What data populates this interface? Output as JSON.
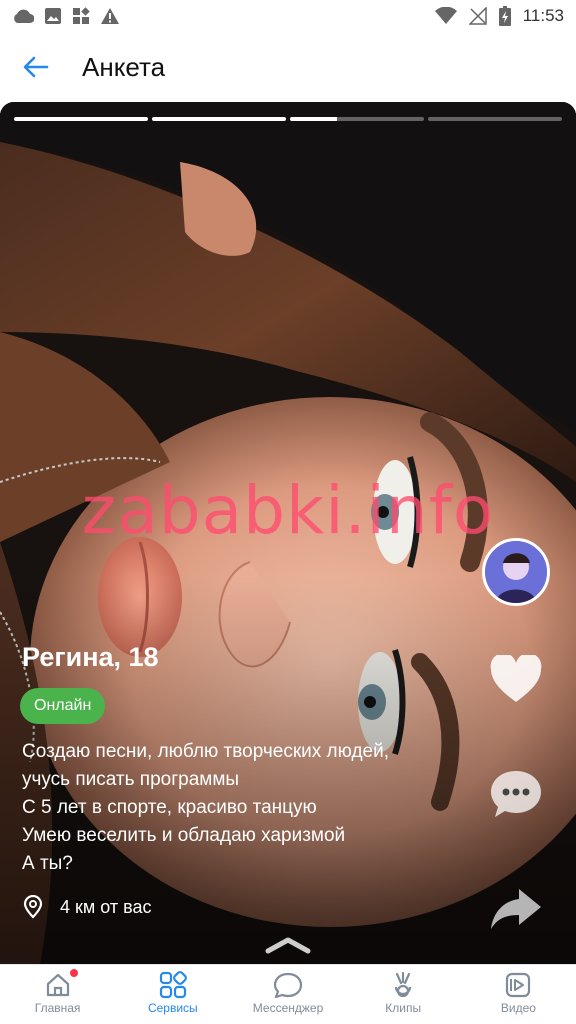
{
  "status_bar": {
    "time": "11:53",
    "left_icons": [
      "cloud-icon",
      "image-icon",
      "apps-icon",
      "warning-icon"
    ],
    "right_icons": [
      "wifi-icon",
      "no-signal-icon",
      "battery-icon"
    ]
  },
  "header": {
    "title": "Анкета",
    "back_icon": "arrow-left-icon"
  },
  "profile": {
    "photo_progress": [
      1,
      1,
      0.35,
      0
    ],
    "watermark": "zababki.info",
    "name_age": "Регина, 18",
    "status_badge": "Онлайн",
    "bio": "Создаю песни, люблю творческих людей,\nучусь писать программы\nС 5 лет в спорте, красиво танцую\nУмею веселить и обладаю харизмой\nА ты?",
    "distance": "4 км от вас"
  },
  "actions": [
    "heart-icon",
    "comment-icon",
    "share-icon"
  ],
  "bottom_nav": {
    "items": [
      {
        "label": "Главная",
        "icon": "home-icon",
        "active": false,
        "notification": true
      },
      {
        "label": "Сервисы",
        "icon": "services-icon",
        "active": true
      },
      {
        "label": "Мессенджер",
        "icon": "messenger-icon",
        "active": false
      },
      {
        "label": "Клипы",
        "icon": "clips-icon",
        "active": false
      },
      {
        "label": "Видео",
        "icon": "video-icon",
        "active": false
      }
    ]
  },
  "colors": {
    "accent": "#2688eb",
    "online": "#4bb34b",
    "nav_inactive": "#818c99",
    "notification": "#ff3347",
    "watermark": "#ff4b6e"
  }
}
